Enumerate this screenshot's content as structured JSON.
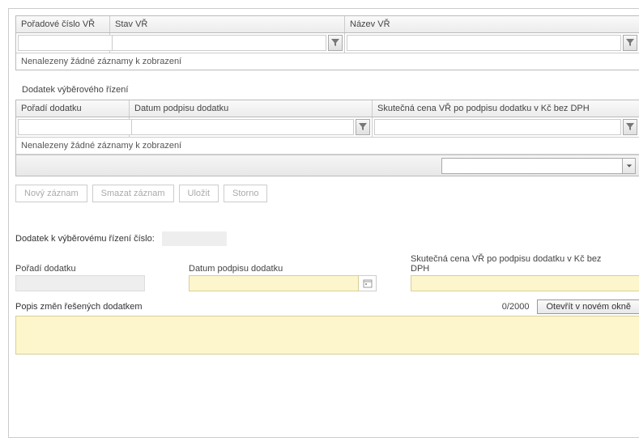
{
  "grid1": {
    "headers": [
      "Pořadové číslo VŘ",
      "Stav VŘ",
      "Název VŘ"
    ],
    "empty": "Nenalezeny žádné záznamy k zobrazení"
  },
  "section2_title": "Dodatek výběrového řízení",
  "grid2": {
    "headers": [
      "Pořadí dodatku",
      "Datum podpisu dodatku",
      "Skutečná cena VŘ po podpisu dodatku v Kč bez DPH"
    ],
    "empty": "Nenalezeny žádné záznamy k zobrazení"
  },
  "buttons": {
    "new": "Nový záznam",
    "delete": "Smazat záznam",
    "save": "Uložit",
    "cancel": "Storno"
  },
  "form": {
    "title_label": "Dodatek k výběrovému řízení číslo:",
    "poradi_label": "Pořadí dodatku",
    "datum_label": "Datum podpisu dodatku",
    "cena_label": "Skutečná cena VŘ po podpisu dodatku v Kč bez DPH",
    "popis_label": "Popis změn řešených dodatkem",
    "counter": "0/2000",
    "open_btn": "Otevřít v novém okně"
  }
}
